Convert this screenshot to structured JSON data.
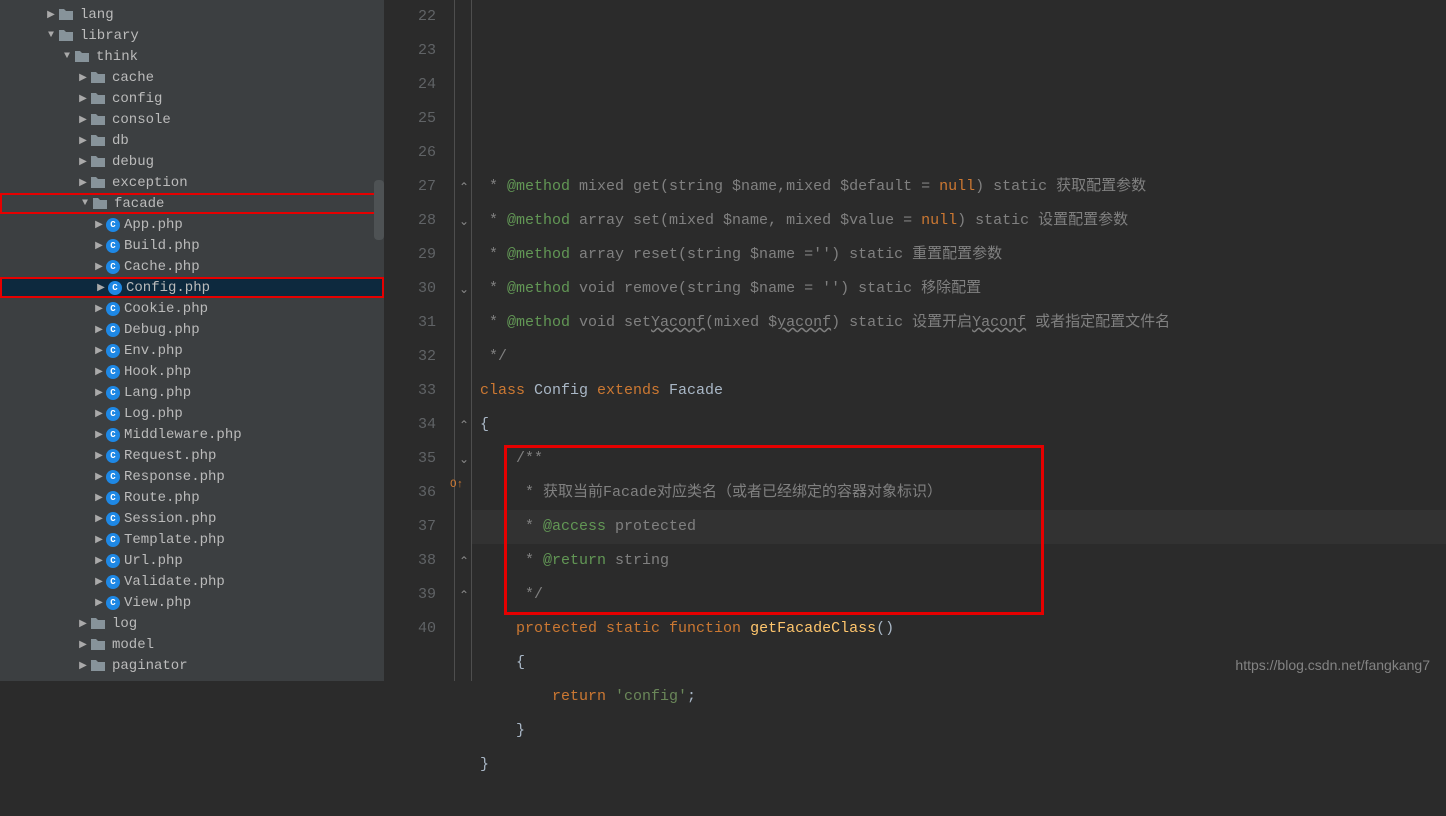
{
  "sidebar": {
    "items": [
      {
        "label": "lang",
        "indent": 1,
        "arrow": "right",
        "icon": "folder"
      },
      {
        "label": "library",
        "indent": 1,
        "arrow": "down",
        "icon": "folder"
      },
      {
        "label": "think",
        "indent": 2,
        "arrow": "down",
        "icon": "folder"
      },
      {
        "label": "cache",
        "indent": 3,
        "arrow": "right",
        "icon": "folder"
      },
      {
        "label": "config",
        "indent": 3,
        "arrow": "right",
        "icon": "folder"
      },
      {
        "label": "console",
        "indent": 3,
        "arrow": "right",
        "icon": "folder"
      },
      {
        "label": "db",
        "indent": 3,
        "arrow": "right",
        "icon": "folder"
      },
      {
        "label": "debug",
        "indent": 3,
        "arrow": "right",
        "icon": "folder"
      },
      {
        "label": "exception",
        "indent": 3,
        "arrow": "right",
        "icon": "folder"
      },
      {
        "label": "facade",
        "indent": 3,
        "arrow": "down",
        "icon": "folder",
        "boxed": true
      },
      {
        "label": "App.php",
        "indent": 4,
        "arrow": "right",
        "icon": "php"
      },
      {
        "label": "Build.php",
        "indent": 4,
        "arrow": "right",
        "icon": "php"
      },
      {
        "label": "Cache.php",
        "indent": 4,
        "arrow": "right",
        "icon": "php"
      },
      {
        "label": "Config.php",
        "indent": 4,
        "arrow": "right",
        "icon": "php",
        "selected": true,
        "boxed": true
      },
      {
        "label": "Cookie.php",
        "indent": 4,
        "arrow": "right",
        "icon": "php"
      },
      {
        "label": "Debug.php",
        "indent": 4,
        "arrow": "right",
        "icon": "php"
      },
      {
        "label": "Env.php",
        "indent": 4,
        "arrow": "right",
        "icon": "php"
      },
      {
        "label": "Hook.php",
        "indent": 4,
        "arrow": "right",
        "icon": "php"
      },
      {
        "label": "Lang.php",
        "indent": 4,
        "arrow": "right",
        "icon": "php"
      },
      {
        "label": "Log.php",
        "indent": 4,
        "arrow": "right",
        "icon": "php"
      },
      {
        "label": "Middleware.php",
        "indent": 4,
        "arrow": "right",
        "icon": "php"
      },
      {
        "label": "Request.php",
        "indent": 4,
        "arrow": "right",
        "icon": "php"
      },
      {
        "label": "Response.php",
        "indent": 4,
        "arrow": "right",
        "icon": "php"
      },
      {
        "label": "Route.php",
        "indent": 4,
        "arrow": "right",
        "icon": "php"
      },
      {
        "label": "Session.php",
        "indent": 4,
        "arrow": "right",
        "icon": "php"
      },
      {
        "label": "Template.php",
        "indent": 4,
        "arrow": "right",
        "icon": "php"
      },
      {
        "label": "Url.php",
        "indent": 4,
        "arrow": "right",
        "icon": "php"
      },
      {
        "label": "Validate.php",
        "indent": 4,
        "arrow": "right",
        "icon": "php"
      },
      {
        "label": "View.php",
        "indent": 4,
        "arrow": "right",
        "icon": "php"
      },
      {
        "label": "log",
        "indent": 3,
        "arrow": "right",
        "icon": "folder"
      },
      {
        "label": "model",
        "indent": 3,
        "arrow": "right",
        "icon": "folder"
      },
      {
        "label": "paginator",
        "indent": 3,
        "arrow": "right",
        "icon": "folder"
      }
    ]
  },
  "editor": {
    "line_start": 22,
    "lines": [
      {
        "n": 22,
        "tokens": [
          {
            "t": " * ",
            "c": "comment"
          },
          {
            "t": "@method",
            "c": "doc"
          },
          {
            "t": " mixed get(string $name,mixed $default = ",
            "c": "comment"
          },
          {
            "t": "null",
            "c": "null"
          },
          {
            "t": ") static ",
            "c": "comment"
          },
          {
            "t": "获取配置参数",
            "c": "comment"
          }
        ]
      },
      {
        "n": 23,
        "tokens": [
          {
            "t": " * ",
            "c": "comment"
          },
          {
            "t": "@method",
            "c": "doc"
          },
          {
            "t": " array set(mixed $name, mixed $value = ",
            "c": "comment"
          },
          {
            "t": "null",
            "c": "null"
          },
          {
            "t": ") static ",
            "c": "comment"
          },
          {
            "t": "设置配置参数",
            "c": "comment"
          }
        ]
      },
      {
        "n": 24,
        "tokens": [
          {
            "t": " * ",
            "c": "comment"
          },
          {
            "t": "@method",
            "c": "doc"
          },
          {
            "t": " array reset(string $name ='') static 重置配置参数",
            "c": "comment"
          }
        ]
      },
      {
        "n": 25,
        "tokens": [
          {
            "t": " * ",
            "c": "comment"
          },
          {
            "t": "@method",
            "c": "doc"
          },
          {
            "t": " void remove(string $name = '') static 移除配置",
            "c": "comment"
          }
        ]
      },
      {
        "n": 26,
        "tokens": [
          {
            "t": " * ",
            "c": "comment"
          },
          {
            "t": "@method",
            "c": "doc"
          },
          {
            "t": " void set",
            "c": "comment"
          },
          {
            "t": "Yaconf",
            "c": "comment",
            "u": true
          },
          {
            "t": "(mixed $",
            "c": "comment"
          },
          {
            "t": "yaconf",
            "c": "comment",
            "u": true
          },
          {
            "t": ") static 设置开启",
            "c": "comment"
          },
          {
            "t": "Yaconf",
            "c": "comment",
            "u": true
          },
          {
            "t": " 或者指定配置文件名",
            "c": "comment"
          }
        ]
      },
      {
        "n": 27,
        "tokens": [
          {
            "t": " */",
            "c": "comment"
          }
        ]
      },
      {
        "n": 28,
        "tokens": [
          {
            "t": "class ",
            "c": "kw"
          },
          {
            "t": "Config ",
            "c": "cls"
          },
          {
            "t": "extends ",
            "c": "kw"
          },
          {
            "t": "Facade",
            "c": "cls"
          }
        ]
      },
      {
        "n": 29,
        "tokens": [
          {
            "t": "{",
            "c": "punct"
          }
        ]
      },
      {
        "n": 30,
        "tokens": [
          {
            "t": "    /**",
            "c": "comment"
          }
        ]
      },
      {
        "n": 31,
        "tokens": [
          {
            "t": "     * 获取当前Facade对应类名（或者已经绑定的容器对象标识）",
            "c": "comment"
          }
        ]
      },
      {
        "n": 32,
        "tokens": [
          {
            "t": "     * ",
            "c": "comment"
          },
          {
            "t": "@access",
            "c": "doc"
          },
          {
            "t": " protected",
            "c": "comment"
          }
        ]
      },
      {
        "n": 33,
        "tokens": [
          {
            "t": "     * ",
            "c": "comment"
          },
          {
            "t": "@return",
            "c": "doc"
          },
          {
            "t": " string",
            "c": "comment"
          }
        ]
      },
      {
        "n": 34,
        "tokens": [
          {
            "t": "     */",
            "c": "comment"
          }
        ]
      },
      {
        "n": 35,
        "tokens": [
          {
            "t": "    ",
            "c": "punct"
          },
          {
            "t": "protected static function ",
            "c": "kw"
          },
          {
            "t": "getFacadeClass",
            "c": "fn"
          },
          {
            "t": "()",
            "c": "punct"
          }
        ]
      },
      {
        "n": 36,
        "tokens": [
          {
            "t": "    {",
            "c": "punct"
          }
        ]
      },
      {
        "n": 37,
        "tokens": [
          {
            "t": "        ",
            "c": "punct"
          },
          {
            "t": "return ",
            "c": "kw"
          },
          {
            "t": "'config'",
            "c": "str"
          },
          {
            "t": ";",
            "c": "punct"
          }
        ]
      },
      {
        "n": 38,
        "tokens": [
          {
            "t": "    }",
            "c": "punct"
          }
        ]
      },
      {
        "n": 39,
        "tokens": [
          {
            "t": "}",
            "c": "punct"
          }
        ]
      },
      {
        "n": 40,
        "tokens": []
      }
    ]
  },
  "watermark": "https://blog.csdn.net/fangkang7",
  "icons": {
    "arrow_right": "▶",
    "arrow_down": "▼",
    "php_letter": "C"
  }
}
